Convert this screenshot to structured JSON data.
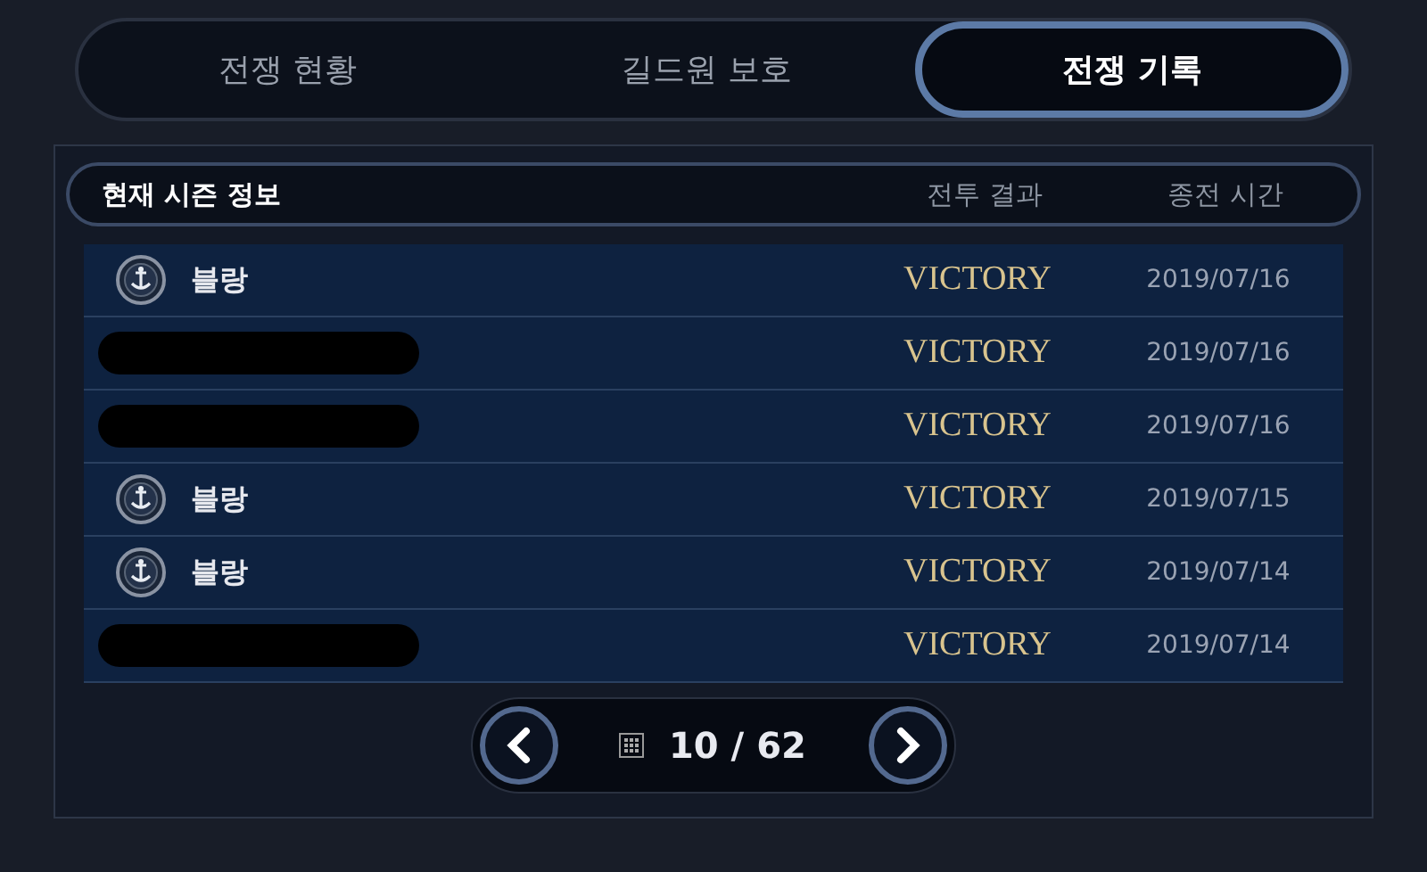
{
  "tabs": [
    {
      "label": "전쟁 현황",
      "selected": false
    },
    {
      "label": "길드원 보호",
      "selected": false
    },
    {
      "label": "전쟁 기록",
      "selected": true
    }
  ],
  "table": {
    "columns": [
      "현재 시즌 정보",
      "전투 결과",
      "종전 시간"
    ],
    "rows": [
      {
        "kind": "guild",
        "name": "블랑",
        "result": "VICTORY",
        "time": "2019/07/16"
      },
      {
        "kind": "redacted",
        "result": "VICTORY",
        "time": "2019/07/16"
      },
      {
        "kind": "redacted",
        "result": "VICTORY",
        "time": "2019/07/16"
      },
      {
        "kind": "guild",
        "name": "블랑",
        "result": "VICTORY",
        "time": "2019/07/15"
      },
      {
        "kind": "guild",
        "name": "블랑",
        "result": "VICTORY",
        "time": "2019/07/14"
      },
      {
        "kind": "redacted",
        "result": "VICTORY",
        "time": "2019/07/14"
      }
    ]
  },
  "pager": {
    "text": "10 / 62"
  }
}
